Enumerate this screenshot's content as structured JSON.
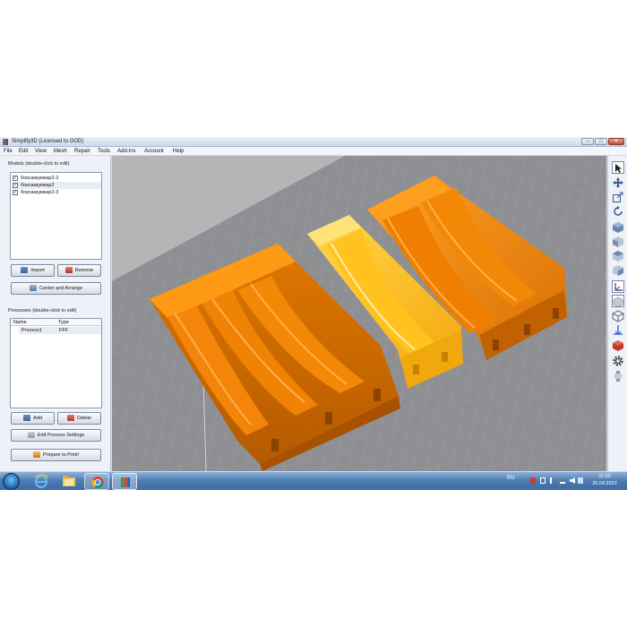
{
  "window": {
    "title": "Simplify3D (Licensed to GOD)",
    "controls": {
      "minimize": "–",
      "maximize": "□",
      "close": "✕"
    }
  },
  "menu": [
    "File",
    "Edit",
    "View",
    "Mesh",
    "Repair",
    "Tools",
    "Add-Ins",
    "Account",
    "Help"
  ],
  "models": {
    "label": "Models (double-click to edit)",
    "items": [
      {
        "name": "боксаккумкар2-2",
        "checked": true
      },
      {
        "name": "боксаккумкар2",
        "checked": true
      },
      {
        "name": "боксаккумкар2-3",
        "checked": true
      }
    ],
    "import_label": "Import",
    "remove_label": "Remove",
    "center_label": "Center and Arrange"
  },
  "processes": {
    "label": "Processes (double-click to edit)",
    "columns": [
      "Name",
      "Type"
    ],
    "rows": [
      {
        "name": "Process1",
        "type": "FFF"
      }
    ],
    "add_label": "Add",
    "delete_label": "Delete",
    "edit_label": "Edit Process Settings",
    "prepare_label": "Prepare to Print!"
  },
  "toolbar_icons": [
    "select-arrow-icon",
    "move-icon",
    "scale-icon",
    "rotate-icon",
    "view-iso-icon",
    "view-front-icon",
    "view-top-icon",
    "view-side-icon",
    "axes-icon",
    "view-box-icon",
    "mesh-view-icon",
    "cross-section-icon",
    "layer-icon",
    "gear-icon",
    "filament-icon"
  ],
  "taskbar": {
    "language": "RU",
    "time": "11:29",
    "date": "25.04.2022",
    "pinned": [
      "internet-explorer-icon",
      "file-explorer-icon",
      "chrome-icon",
      "simplify3d-icon"
    ]
  },
  "colors": {
    "model_orange": "#f38806",
    "model_selected": "#ffbf1a",
    "bed_grid": "#8d8e91",
    "accent": "#3d6aa0"
  }
}
